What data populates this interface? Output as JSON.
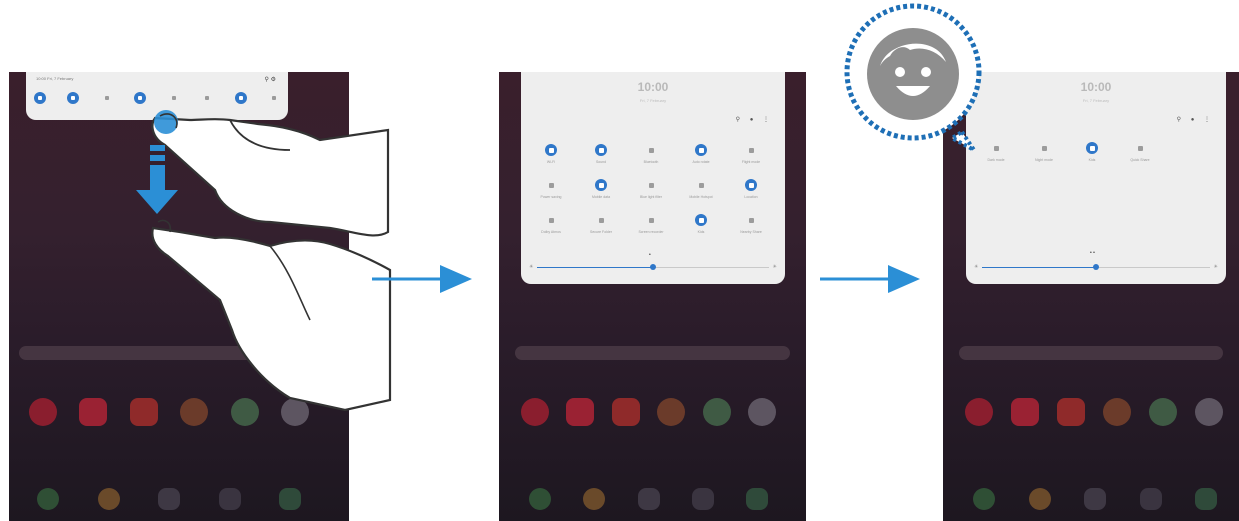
{
  "panel1": {
    "status_text": "10:00 Fri, 7 February",
    "tiles": [
      "on",
      "on",
      "off",
      "on",
      "off",
      "off",
      "on",
      "off"
    ]
  },
  "panel2": {
    "clock": "10:00",
    "date": "Fri, 7 February",
    "tiles": [
      {
        "label": "Wi-Fi",
        "state": "on"
      },
      {
        "label": "Sound",
        "state": "on"
      },
      {
        "label": "Bluetooth",
        "state": "off"
      },
      {
        "label": "Auto rotate",
        "state": "on"
      },
      {
        "label": "Flight mode",
        "state": "off"
      },
      {
        "label": "Power saving",
        "state": "off"
      },
      {
        "label": "Mobile data",
        "state": "on"
      },
      {
        "label": "Blue light filter",
        "state": "off"
      },
      {
        "label": "Mobile Hotspot",
        "state": "off"
      },
      {
        "label": "Location",
        "state": "on"
      },
      {
        "label": "Dolby Atmos",
        "state": "off"
      },
      {
        "label": "Secure Folder",
        "state": "off"
      },
      {
        "label": "Screen recorder",
        "state": "off"
      },
      {
        "label": "Kids",
        "state": "on"
      },
      {
        "label": "Nearby Share",
        "state": "off"
      }
    ],
    "brightness": 0.5
  },
  "panel3": {
    "clock": "10:00",
    "date": "Fri, 7 February",
    "tiles": [
      {
        "label": "Dark mode",
        "state": "off"
      },
      {
        "label": "Night mode",
        "state": "off"
      },
      {
        "label": "Kids",
        "state": "on"
      },
      {
        "label": "Quick Share",
        "state": "off"
      }
    ],
    "brightness": 0.5
  },
  "colors": {
    "accent": "#2f77c9",
    "arrow": "#2b8fd6",
    "badge_dots": "#1e6fb6",
    "badge_face": "#8e8e8e"
  },
  "icons": {
    "kids_badge": "kids-face-icon",
    "gesture": "two-finger-swipe-down-icon",
    "arrow": "right-arrow-icon"
  }
}
